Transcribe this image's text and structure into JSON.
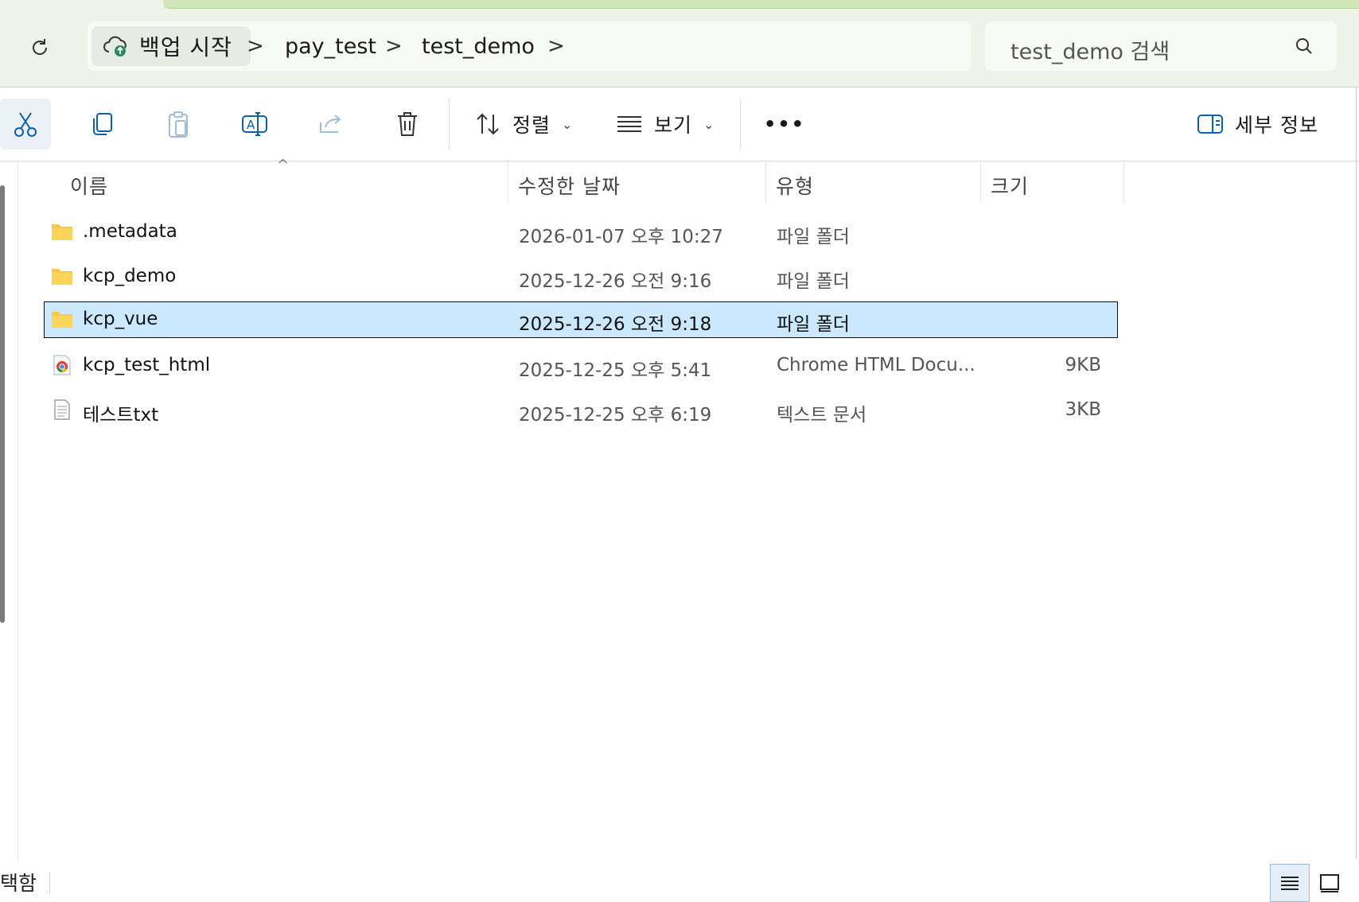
{
  "address_bar": {
    "home_label": "백업 시작",
    "breadcrumb": [
      "pay_test",
      "test_demo"
    ],
    "chevron": ">"
  },
  "search": {
    "placeholder": "test_demo 검색"
  },
  "toolbar": {
    "cut": "cut-icon",
    "copy": "copy-icon",
    "paste": "paste-icon",
    "rename": "rename-icon",
    "share": "share-icon",
    "delete": "delete-icon",
    "sort_label": "정렬",
    "view_label": "보기",
    "more_label": "•••",
    "details_label": "세부 정보",
    "dropdown_glyph": "⌄"
  },
  "columns": {
    "name": "이름",
    "date": "수정한 날짜",
    "type": "유형",
    "size": "크기",
    "sort_indicator": "^"
  },
  "files": [
    {
      "name": ".metadata",
      "date": "2026-01-07 오후 10:27",
      "type": "파일 폴더",
      "size": "",
      "icon": "folder-icon",
      "selected": false
    },
    {
      "name": "kcp_demo",
      "date": "2025-12-26 오전 9:16",
      "type": "파일 폴더",
      "size": "",
      "icon": "folder-icon",
      "selected": false
    },
    {
      "name": "kcp_vue",
      "date": "2025-12-26 오전 9:18",
      "type": "파일 폴더",
      "size": "",
      "icon": "folder-icon",
      "selected": true
    },
    {
      "name": "kcp_test_html",
      "date": "2025-12-25 오후 5:41",
      "type": "Chrome HTML Docu...",
      "size": "9KB",
      "icon": "chrome-html-icon",
      "selected": false
    },
    {
      "name": "테스트txt",
      "date": "2025-12-25 오후 6:19",
      "type": "텍스트 문서",
      "size": "3KB",
      "icon": "text-file-icon",
      "selected": false
    }
  ],
  "status_bar": {
    "text": "택함"
  },
  "colors": {
    "selected_row": "#cce8ff",
    "folder": "#f7c948",
    "accent": "#0067c0"
  }
}
